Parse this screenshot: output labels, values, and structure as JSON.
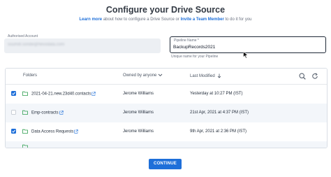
{
  "header": {
    "title": "Configure your Drive Source",
    "learn_more": "Learn more",
    "subtitle_mid": "about how to configure a Drive Source or",
    "invite": "Invite a Team Member",
    "subtitle_end": "to do it for you"
  },
  "authorised_account": {
    "label": "Authorised Account",
    "value": "soumitr.sonde@hevodata.com"
  },
  "pipeline_name": {
    "label": "Pipeline Name *",
    "value": "BackupRecords2021",
    "hint": "Unique name for your Pipeline"
  },
  "table": {
    "headers": {
      "folders": "Folders",
      "owned_by": "Owned by anyone",
      "last_modified": "Last Modified"
    },
    "rows": [
      {
        "checked": true,
        "folder": "2021-04-21.new.23d40.contacts",
        "owner": "Jerome Williams",
        "modified": "Yesterday at 10:27 PM (IST)"
      },
      {
        "checked": false,
        "folder": "Emp-contracts",
        "owner": "Jerome Williams",
        "modified": "21st Apr, 2021 at 4:37 PM (IST)"
      },
      {
        "checked": true,
        "folder": "Data Access Requests",
        "owner": "Jerome Williams",
        "modified": "9th Apr, 2021 at 2:36 PM (IST)"
      }
    ]
  },
  "continue_label": "CONTINUE",
  "colors": {
    "accent": "#1e6fd9",
    "folder_icon": "#2e9e4f"
  }
}
